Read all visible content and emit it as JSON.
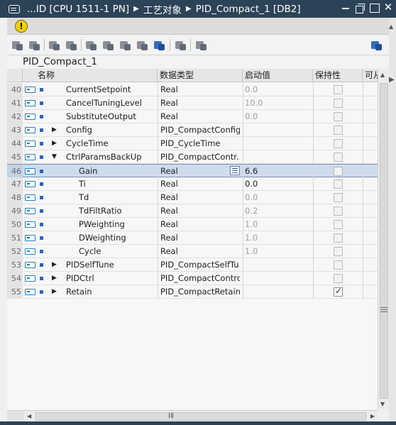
{
  "window": {
    "breadcrumb": [
      "...ID [CPU 1511-1 PN]",
      "工艺对象",
      "PID_Compact_1 [DB2]"
    ],
    "separator": "▶",
    "close_glyph": "✕"
  },
  "warning": {
    "glyph": "!",
    "icon": "warning-icon"
  },
  "toolbar": {
    "icons": [
      "insert-row-icon",
      "add-row-icon",
      "snapshot-icon",
      "copy-snapshot-icon",
      "load-start-values-icon",
      "initialize-icon",
      "reset-icon",
      "monitor-icon",
      "expand-all-icon",
      "keep-actual-values-icon",
      "glasses-monitor-icon",
      "settings-icon"
    ]
  },
  "db_name": "PID_Compact_1",
  "columns": {
    "name": "名称",
    "type": "数据类型",
    "start": "启动值",
    "retain": "保持性",
    "access": "可从"
  },
  "scroll": {
    "up": "▲",
    "down": "▼",
    "left": "◀",
    "right": "▶"
  },
  "rows": [
    {
      "num": "40",
      "name": "CurrentSetpoint",
      "type": "Real",
      "start": "0.0",
      "start_dim": true,
      "level": 1,
      "expander": "",
      "retain": false
    },
    {
      "num": "41",
      "name": "CancelTuningLevel",
      "type": "Real",
      "start": "10.0",
      "start_dim": true,
      "level": 1,
      "expander": "",
      "retain": false
    },
    {
      "num": "42",
      "name": "SubstituteOutput",
      "type": "Real",
      "start": "0.0",
      "start_dim": true,
      "level": 1,
      "expander": "",
      "retain": false
    },
    {
      "num": "43",
      "name": "Config",
      "type": "PID_CompactConfig",
      "start": "",
      "start_dim": false,
      "level": 1,
      "expander": "▶",
      "retain": false
    },
    {
      "num": "44",
      "name": "CycleTime",
      "type": "PID_CycleTime",
      "start": "",
      "start_dim": false,
      "level": 1,
      "expander": "▶",
      "retain": false
    },
    {
      "num": "45",
      "name": "CtrlParamsBackUp",
      "type": "PID_CompactContr...",
      "start": "",
      "start_dim": false,
      "level": 1,
      "expander": "▼",
      "retain": false
    },
    {
      "num": "46",
      "name": "Gain",
      "type": "Real",
      "start": "6.6",
      "start_dim": false,
      "level": 2,
      "expander": "",
      "retain": false,
      "selected": true
    },
    {
      "num": "47",
      "name": "Ti",
      "type": "Real",
      "start": "0.0",
      "start_dim": false,
      "level": 2,
      "expander": "",
      "retain": false
    },
    {
      "num": "48",
      "name": "Td",
      "type": "Real",
      "start": "0.0",
      "start_dim": true,
      "level": 2,
      "expander": "",
      "retain": false
    },
    {
      "num": "49",
      "name": "TdFiltRatio",
      "type": "Real",
      "start": "0.2",
      "start_dim": true,
      "level": 2,
      "expander": "",
      "retain": false
    },
    {
      "num": "50",
      "name": "PWeighting",
      "type": "Real",
      "start": "1.0",
      "start_dim": true,
      "level": 2,
      "expander": "",
      "retain": false
    },
    {
      "num": "51",
      "name": "DWeighting",
      "type": "Real",
      "start": "1.0",
      "start_dim": true,
      "level": 2,
      "expander": "",
      "retain": false
    },
    {
      "num": "52",
      "name": "Cycle",
      "type": "Real",
      "start": "1.0",
      "start_dim": true,
      "level": 2,
      "expander": "",
      "retain": false
    },
    {
      "num": "53",
      "name": "PIDSelfTune",
      "type": "PID_CompactSelfTu...",
      "start": "",
      "start_dim": false,
      "level": 1,
      "expander": "▶",
      "retain": false
    },
    {
      "num": "54",
      "name": "PIDCtrl",
      "type": "PID_CompactControl",
      "start": "",
      "start_dim": false,
      "level": 1,
      "expander": "▶",
      "retain": false
    },
    {
      "num": "55",
      "name": "Retain",
      "type": "PID_CompactRetain",
      "start": "",
      "start_dim": false,
      "level": 1,
      "expander": "▶",
      "retain": true
    }
  ]
}
